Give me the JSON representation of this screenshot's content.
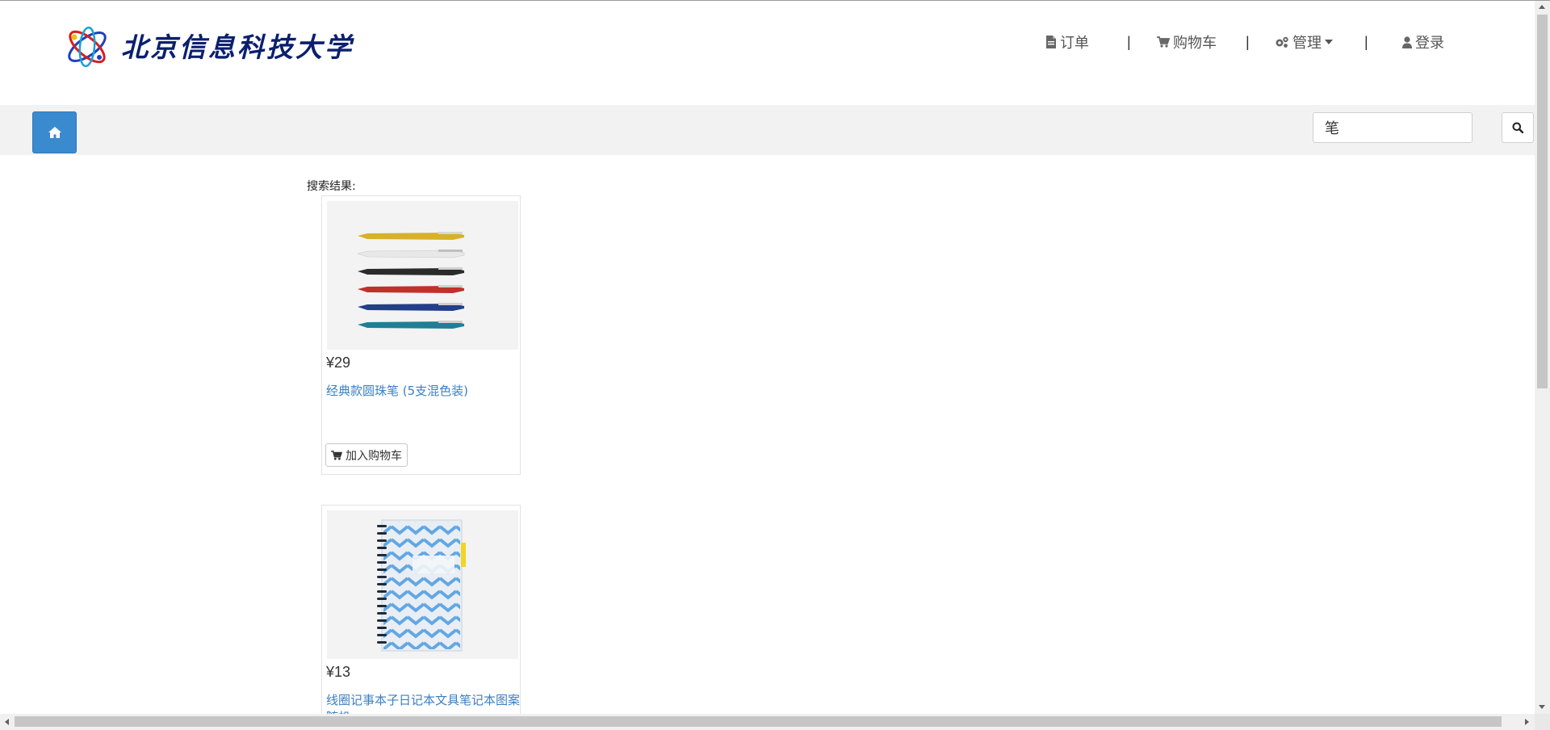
{
  "header": {
    "logo_text": "北京信息科技大学",
    "nav": {
      "orders": "订单",
      "cart": "购物车",
      "admin": "管理",
      "login": "登录",
      "separator": "|"
    }
  },
  "search": {
    "value": "笔"
  },
  "results": {
    "label": "搜索结果:",
    "cart_button_label": "加入购物车",
    "items": [
      {
        "price": "¥29",
        "name": "经典款圆珠笔 (5支混色装)",
        "image": "pens"
      },
      {
        "price": "¥13",
        "name": "线圈记事本子日记本文具笔记本图案随机",
        "image": "notebook"
      }
    ]
  },
  "colors": {
    "accent": "#3a8ad0",
    "link": "#3c7fc1",
    "toolbar_bg": "#f2f2f2"
  },
  "icons": {
    "orders": "file-icon",
    "cart": "cart-icon",
    "admin": "gears-icon",
    "login": "user-icon",
    "home": "home-icon",
    "search": "search-icon"
  }
}
